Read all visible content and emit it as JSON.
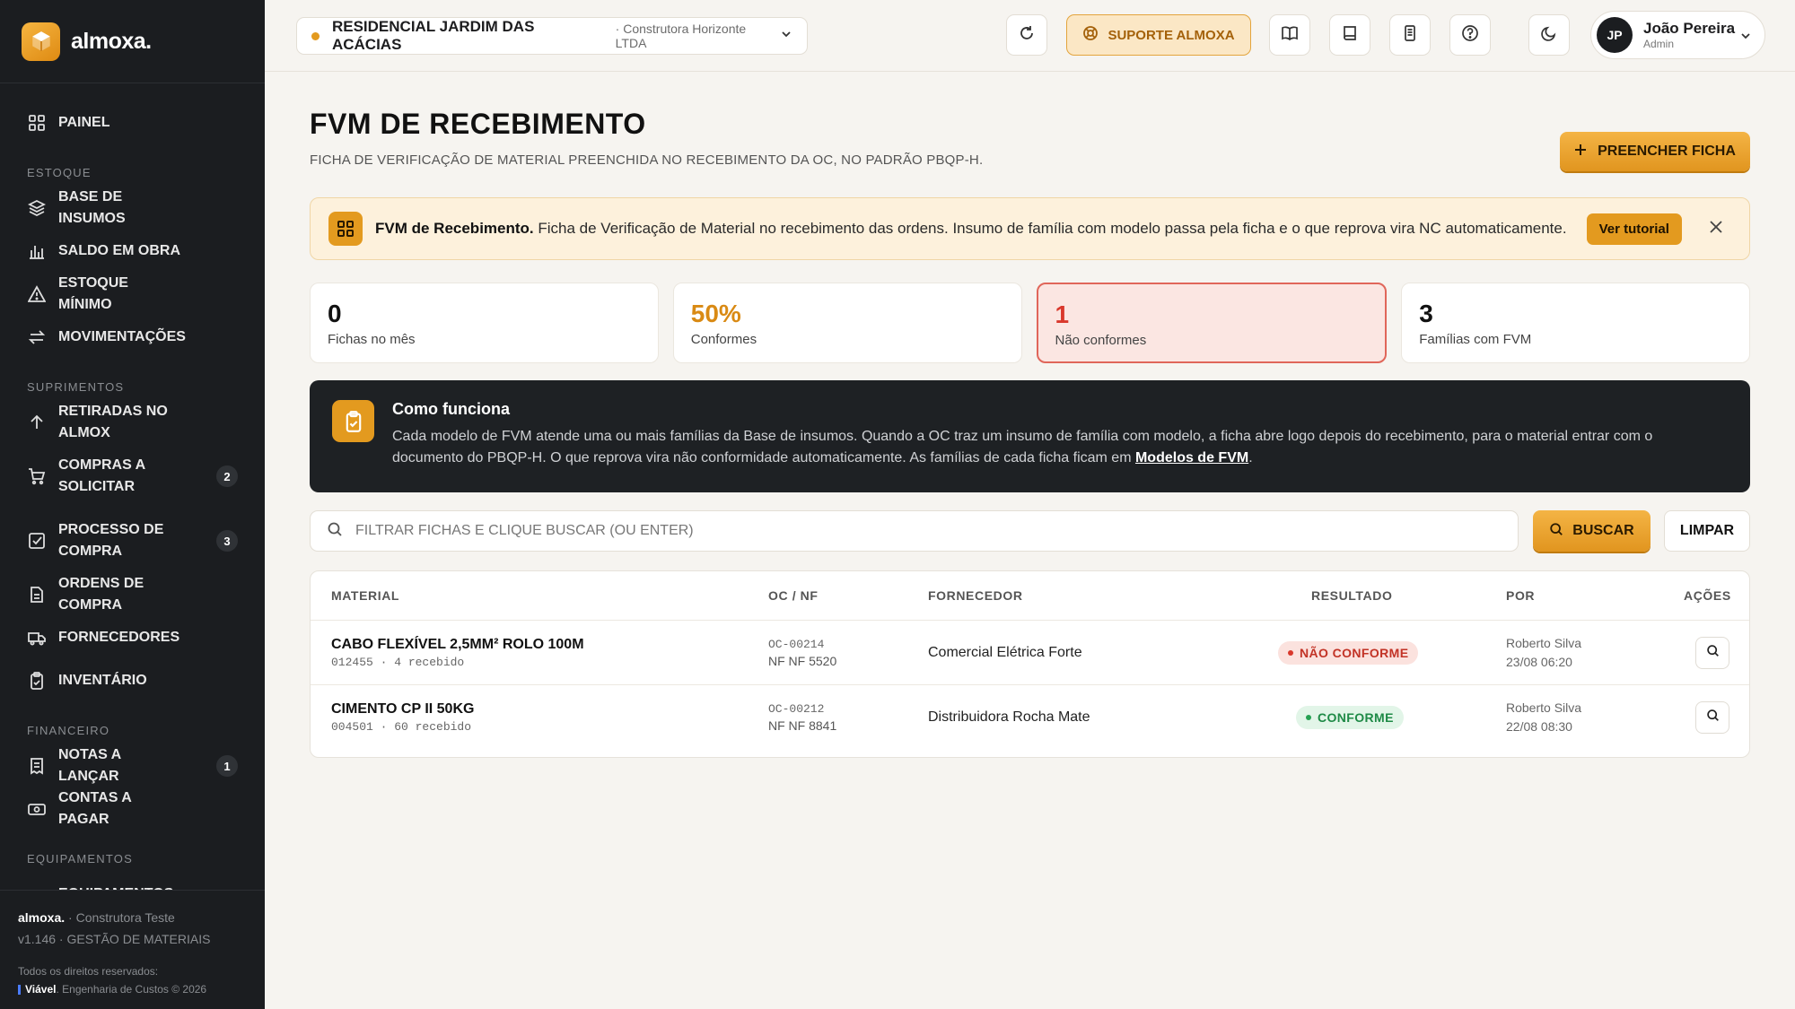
{
  "brand": {
    "name": "almoxa."
  },
  "sidebar": {
    "painel": "PAINEL",
    "sections": {
      "estoque": "ESTOQUE",
      "suprimentos": "SUPRIMENTOS",
      "financeiro": "FINANCEIRO",
      "equipamentos": "EQUIPAMENTOS"
    },
    "items": {
      "base_insumos": "BASE DE INSUMOS",
      "saldo_obra": "SALDO EM OBRA",
      "estoque_minimo": "ESTOQUE MÍNIMO",
      "movimentacoes": "MOVIMENTAÇÕES",
      "retiradas": "RETIRADAS NO ALMOX",
      "compras_solicitar": "COMPRAS A SOLICITAR",
      "compras_solicitar_badge": "2",
      "processo_compra": "PROCESSO DE COMPRA",
      "processo_compra_badge": "3",
      "ordens_compra": "ORDENS DE COMPRA",
      "fornecedores": "FORNECEDORES",
      "inventario": "INVENTÁRIO",
      "notas_lancar": "NOTAS A LANÇAR",
      "notas_lancar_badge": "1",
      "contas_pagar": "CONTAS A PAGAR",
      "equipamentos": "EQUIPAMENTOS"
    },
    "footer": {
      "brand": "almoxa.",
      "company": " · Construtora Teste",
      "version": "v1.146 · GESTÃO DE MATERIAIS",
      "rights": "Todos os direitos reservados:",
      "viavel": "Viável",
      "viavel_rest": ". Engenharia de Custos © 2026"
    }
  },
  "topbar": {
    "project_name": "RESIDENCIAL JARDIM DAS ACÁCIAS",
    "project_company": "· Construtora Horizonte LTDA",
    "support_label": "SUPORTE ALMOXA",
    "user_initials": "JP",
    "user_name": "João Pereira",
    "user_role": "Admin"
  },
  "page": {
    "title": "FVM DE RECEBIMENTO",
    "subtitle": "FICHA DE VERIFICAÇÃO DE MATERIAL PREENCHIDA NO RECEBIMENTO DA OC, NO PADRÃO PBQP-H.",
    "primary_button": "PREENCHER FICHA"
  },
  "banner": {
    "title": "FVM de Recebimento.",
    "text": " Ficha de Verificação de Material no recebimento das ordens. Insumo de família com modelo passa pela ficha e o que reprova vira NC automaticamente.",
    "button": "Ver tutorial"
  },
  "stats": [
    {
      "value": "0",
      "label": "Fichas no mês"
    },
    {
      "value": "50%",
      "label": "Conformes"
    },
    {
      "value": "1",
      "label": "Não conformes"
    },
    {
      "value": "3",
      "label": "Famílias com FVM"
    }
  ],
  "how": {
    "title": "Como funciona",
    "text": "Cada modelo de FVM atende uma ou mais famílias da Base de insumos. Quando a OC traz um insumo de família com modelo, a ficha abre logo depois do recebimento, para o material entrar com o documento do PBQP-H. O que reprova vira não conformidade automaticamente. As famílias de cada ficha ficam em ",
    "link": "Modelos de FVM",
    "tail": "."
  },
  "search": {
    "placeholder": "FILTRAR FICHAS E CLIQUE BUSCAR (OU ENTER)",
    "value": "",
    "search_button": "BUSCAR",
    "clear_button": "LIMPAR"
  },
  "table": {
    "headers": {
      "material": "MATERIAL",
      "oc_nf": "OC / NF",
      "fornecedor": "FORNECEDOR",
      "resultado": "RESULTADO",
      "por": "POR",
      "acoes": "AÇÕES"
    },
    "rows": [
      {
        "material": "CABO FLEXÍVEL 2,5MM² ROLO 100M",
        "meta": "012455 · 4 recebido",
        "oc": "OC-00214",
        "nf": "NF NF 5520",
        "fornecedor": "Comercial Elétrica Forte",
        "resultado": "NÃO CONFORME",
        "por_nome": "Roberto Silva",
        "por_data": "23/08 06:20"
      },
      {
        "material": "CIMENTO CP II 50KG",
        "meta": "004501 · 60 recebido",
        "oc": "OC-00212",
        "nf": "NF NF 8841",
        "fornecedor": "Distribuidora Rocha Mate",
        "resultado": "CONFORME",
        "por_nome": "Roberto Silva",
        "por_data": "22/08 08:30"
      }
    ]
  },
  "colors": {
    "accent": "#e39a1f",
    "sidebar_bg": "#1b1d20",
    "danger": "#d9382c",
    "success": "#25a152"
  }
}
